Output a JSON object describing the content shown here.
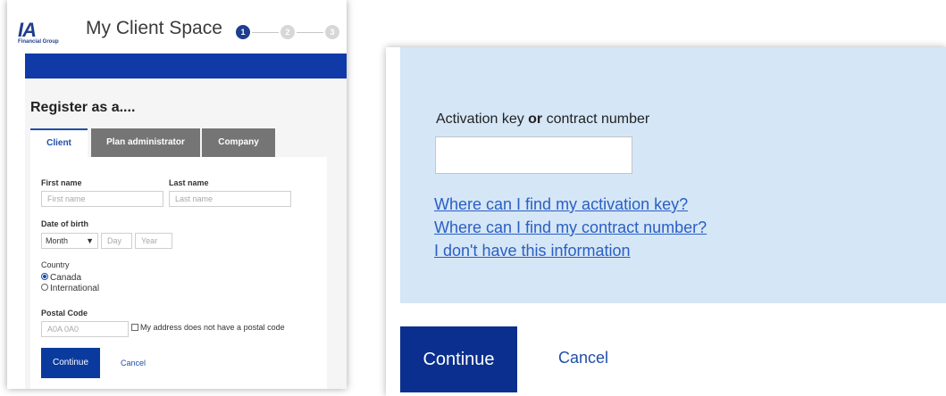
{
  "left_screen": {
    "header": {
      "logo_text": "IA",
      "logo_subtext": "Financial Group",
      "app_title": "My Client Space",
      "steps": [
        "1",
        "2",
        "3"
      ]
    },
    "register_title": "Register as a....",
    "tabs": [
      {
        "label": "Client",
        "active": true
      },
      {
        "label": "Plan administrator",
        "active": false
      },
      {
        "label": "Company",
        "active": false
      }
    ],
    "form": {
      "first_name": {
        "label": "First name",
        "placeholder": "First name"
      },
      "last_name": {
        "label": "Last name",
        "placeholder": "Last name"
      },
      "dob": {
        "label": "Date of birth",
        "month_value": "Month",
        "day_placeholder": "Day",
        "year_placeholder": "Year"
      },
      "country": {
        "label": "Country",
        "options": [
          {
            "label": "Canada",
            "checked": true
          },
          {
            "label": "International",
            "checked": false
          }
        ]
      },
      "postal_code": {
        "label": "Postal Code",
        "placeholder": "A0A 0A0",
        "no_postal_label": "My address does not have a postal code"
      },
      "continue_label": "Continue",
      "cancel_label": "Cancel"
    }
  },
  "right_screen": {
    "field_label_pre": "Activation key ",
    "field_label_bold": "or",
    "field_label_post": " contract number",
    "links": [
      "Where can I find my activation key?",
      "Where can I find my contract number?",
      "I don't have this information"
    ],
    "continue_label": "Continue",
    "cancel_label": "Cancel"
  },
  "colors": {
    "brand_blue": "#0f3aa8",
    "button_blue": "#0a2f8e",
    "link_blue": "#2a5fc4",
    "info_bg": "#d5e6f6",
    "tab_gray": "#757575"
  }
}
